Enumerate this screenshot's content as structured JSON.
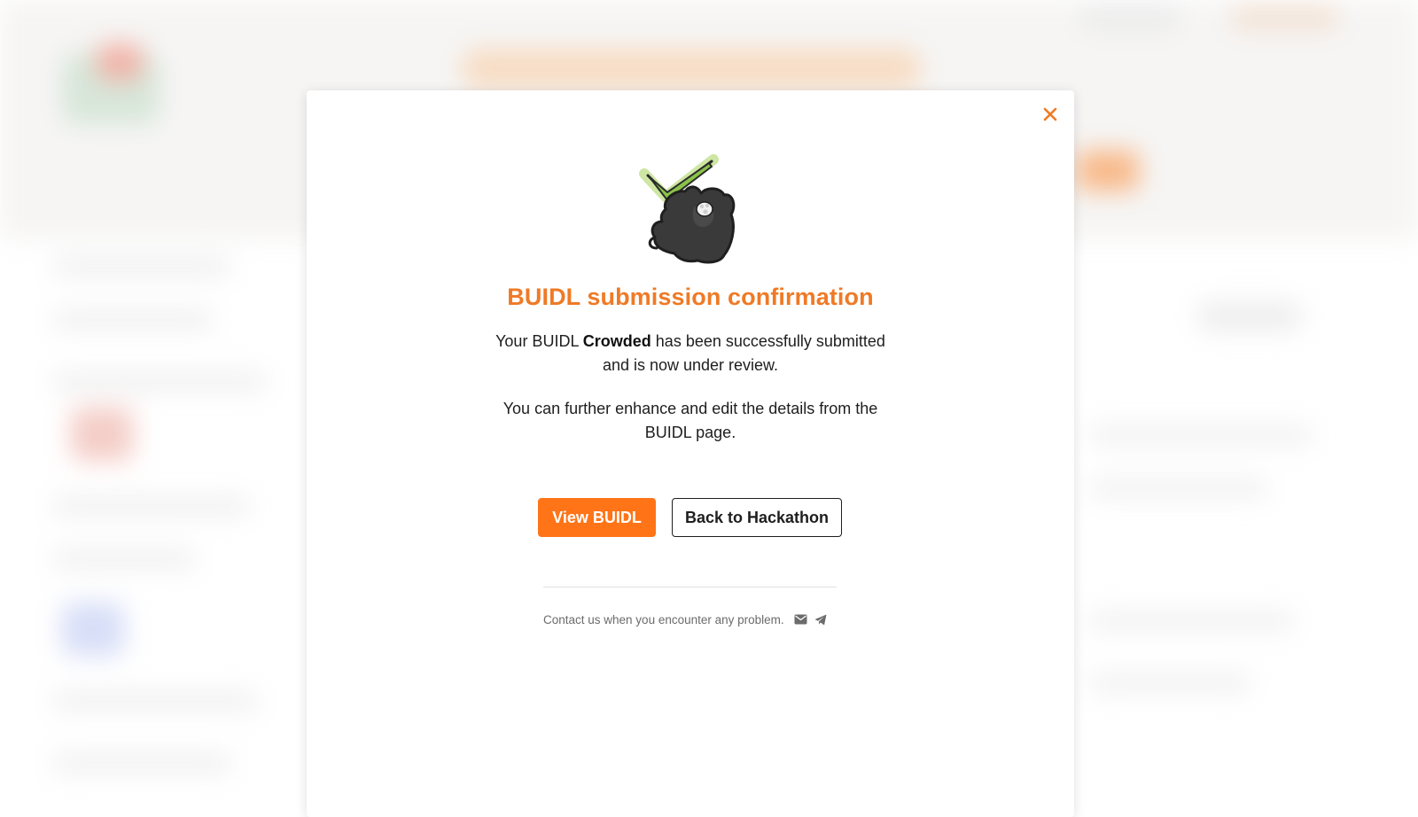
{
  "modal": {
    "title": "BUIDL submission confirmation",
    "message_prefix": "Your BUIDL ",
    "buidl_name": "Crowded",
    "message_suffix": " has been successfully submitted and is now under review.",
    "enhance_text": "You can further enhance and edit the details from the BUIDL page.",
    "primary_button": "View BUIDL",
    "secondary_button": "Back to Hackathon",
    "contact_text": "Contact us when you encounter any problem.",
    "icons": {
      "close": "close-icon",
      "illustration": "cat-checkmark-illustration",
      "mail": "mail-icon",
      "telegram": "telegram-icon"
    }
  },
  "colors": {
    "accent": "#ef7a26",
    "primary_button": "#ff7417",
    "text": "#1e1e1e",
    "muted": "#6b6b6b"
  }
}
